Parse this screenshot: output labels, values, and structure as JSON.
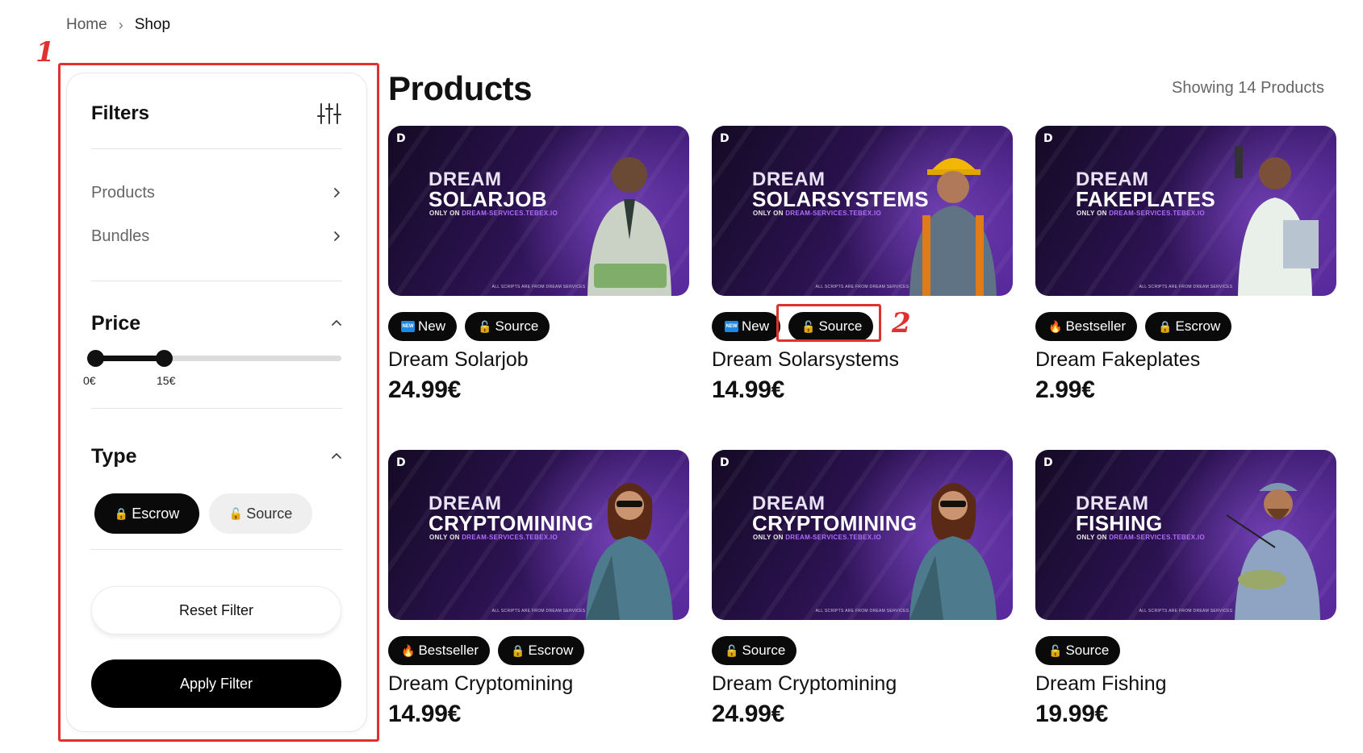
{
  "breadcrumb": {
    "home": "Home",
    "separator": "›",
    "current": "Shop"
  },
  "annotations": {
    "sidebar_marker": "1",
    "badge_marker": "2",
    "color": "#e03131"
  },
  "sidebar": {
    "title": "Filters",
    "icons": {
      "filter": "sliders-icon",
      "chevron_right": "chevron-right-icon",
      "chevron_up": "chevron-up-icon"
    },
    "nav": [
      {
        "label": "Products"
      },
      {
        "label": "Bundles"
      }
    ],
    "price": {
      "title": "Price",
      "min_label": "0€",
      "max_label": "15€",
      "selected_fraction": 0.29
    },
    "type": {
      "title": "Type",
      "options": [
        {
          "label": "Escrow",
          "icon": "lock-icon",
          "glyph": "🔒",
          "selected": true
        },
        {
          "label": "Source",
          "icon": "unlock-icon",
          "glyph": "🔓",
          "selected": false
        }
      ]
    },
    "reset_label": "Reset Filter",
    "apply_label": "Apply Filter"
  },
  "main": {
    "title": "Products",
    "showing": "Showing 14 Products"
  },
  "thumb_text": {
    "brand": "DREAM",
    "only_on": "ONLY ON",
    "site": "DREAM-SERVICES.TEBEX.IO",
    "footer": "ALL SCRIPTS ARE FROM DREAM SERVICES",
    "logo": "D"
  },
  "products": [
    {
      "thumb_name": "SOLARJOB",
      "title": "Dream Solarjob",
      "price": "24.99€",
      "figure": "businessman-figure",
      "badges": [
        {
          "label": "New",
          "icon": "new-icon"
        },
        {
          "label": "Source",
          "icon": "unlock-icon",
          "glyph": "🔓"
        }
      ]
    },
    {
      "thumb_name": "SOLARSYSTEMS",
      "title": "Dream Solarsystems",
      "price": "14.99€",
      "figure": "worker-figure",
      "badges": [
        {
          "label": "New",
          "icon": "new-icon"
        },
        {
          "label": "Source",
          "icon": "unlock-icon",
          "glyph": "🔓"
        }
      ]
    },
    {
      "thumb_name": "FAKEPLATES",
      "title": "Dream Fakeplates",
      "price": "2.99€",
      "figure": "gunman-figure",
      "badges": [
        {
          "label": "Bestseller",
          "icon": "fire-icon",
          "glyph": "🔥"
        },
        {
          "label": "Escrow",
          "icon": "lock-icon",
          "glyph": "🔒"
        }
      ]
    },
    {
      "thumb_name": "CRYPTOMINING",
      "title": "Dream Cryptomining",
      "price": "14.99€",
      "figure": "woman-figure",
      "badges": [
        {
          "label": "Bestseller",
          "icon": "fire-icon",
          "glyph": "🔥"
        },
        {
          "label": "Escrow",
          "icon": "lock-icon",
          "glyph": "🔒"
        }
      ]
    },
    {
      "thumb_name": "CRYPTOMINING",
      "title": "Dream Cryptomining",
      "price": "24.99€",
      "figure": "woman-figure",
      "badges": [
        {
          "label": "Source",
          "icon": "unlock-icon",
          "glyph": "🔓"
        }
      ]
    },
    {
      "thumb_name": "FISHING",
      "title": "Dream Fishing",
      "price": "19.99€",
      "figure": "fisherman-figure",
      "badges": [
        {
          "label": "Source",
          "icon": "unlock-icon",
          "glyph": "🔓"
        }
      ]
    }
  ]
}
